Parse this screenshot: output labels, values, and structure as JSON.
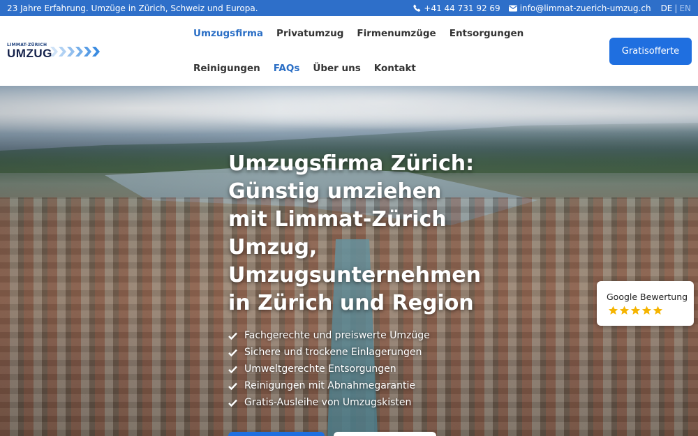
{
  "topbar": {
    "tagline": "23 Jahre Erfahrung. Umzüge in Zürich, Schweiz und Europa.",
    "phone": "+41 44 731 92 69",
    "email": "info@limmat-zuerich-umzug.ch",
    "lang_active": "DE",
    "lang_separator": "|",
    "lang_inactive": "EN",
    "icons": [
      "phone-icon",
      "envelope-icon"
    ]
  },
  "logo": {
    "small_text": "LIMMAT-ZÜRICH",
    "big_text": "UMZUG"
  },
  "nav": {
    "row1": [
      "Umzugsfirma",
      "Privatumzug",
      "Firmenumzüge",
      "Entsorgungen"
    ],
    "row2": [
      "Reinigungen",
      "FAQs",
      "Über uns",
      "Kontakt"
    ],
    "active_color": "#2a6ec5"
  },
  "cta_label": "Gratisofferte",
  "hero": {
    "title_lines": [
      "Umzugsfirma Zürich:",
      "Günstig umziehen",
      "mit Limmat-Zürich",
      "Umzug,",
      "Umzugsunternehmen",
      "in Zürich und Region"
    ],
    "features": [
      "Fachgerechte und preiswerte Umzüge",
      "Sichere und trockene Einlagerungen",
      "Umweltgerechte Entsorgungen",
      "Reinigungen mit Abnahmegarantie",
      "Gratis-Ausleihe von Umzugskisten"
    ]
  },
  "google_badge": {
    "label": "Google Bewertung",
    "rating": 5,
    "star_color": "#f5b400"
  },
  "colors": {
    "brand_blue": "#2e6fc9",
    "button_blue": "#1f6fe0"
  }
}
